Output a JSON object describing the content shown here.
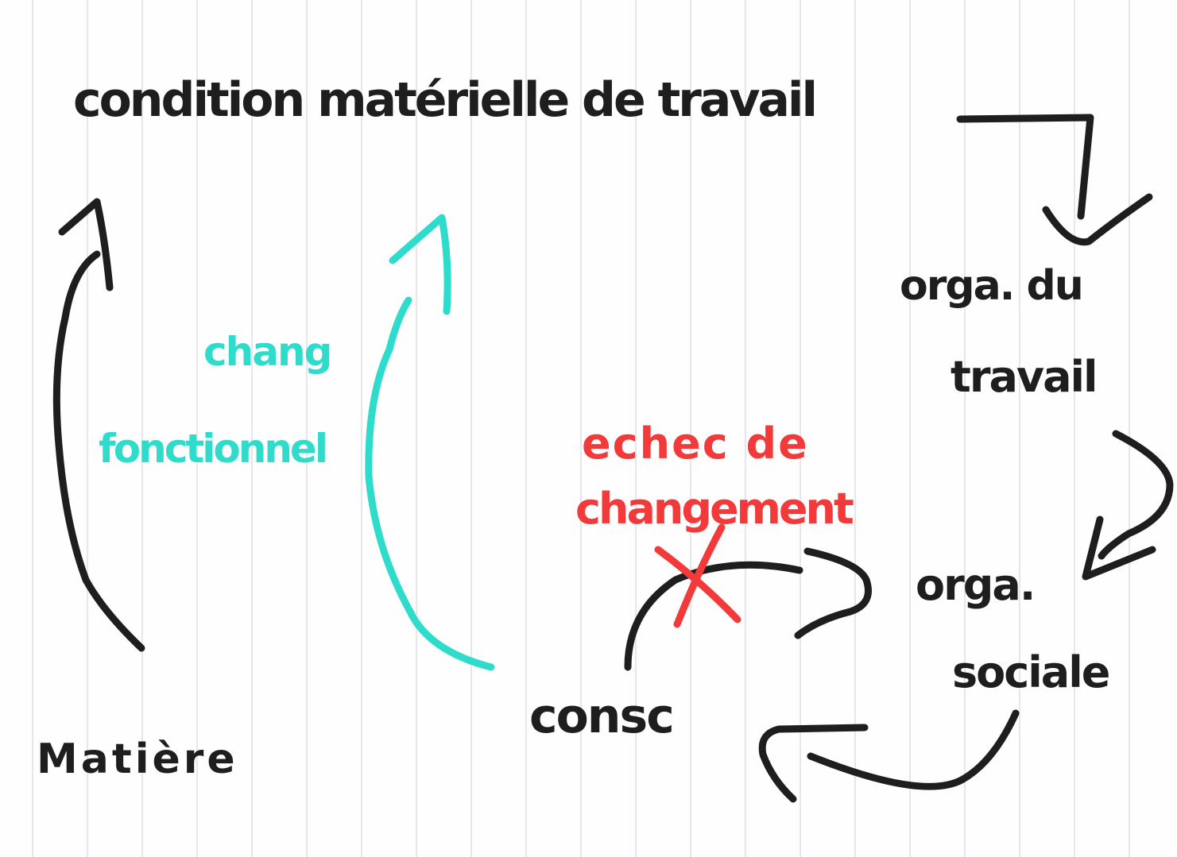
{
  "colors": {
    "black_ink": "#1e1e1e",
    "teal_ink": "#2fdccb",
    "red_ink": "#f23a3a",
    "paper": "#fefefe",
    "rule_line": "#e6e6ec"
  },
  "labels": {
    "top_node": "condition matérielle de travail",
    "orga_travail_line1": "orga. du",
    "orga_travail_line2": "travail",
    "orga_sociale_line1": "orga.",
    "orga_sociale_line2": "sociale",
    "conscience": "consc",
    "matiere": "Matière",
    "teal_line1": "chang",
    "teal_line2": "fonctionnel",
    "red_line1": "echec de",
    "red_line2": "changement"
  }
}
